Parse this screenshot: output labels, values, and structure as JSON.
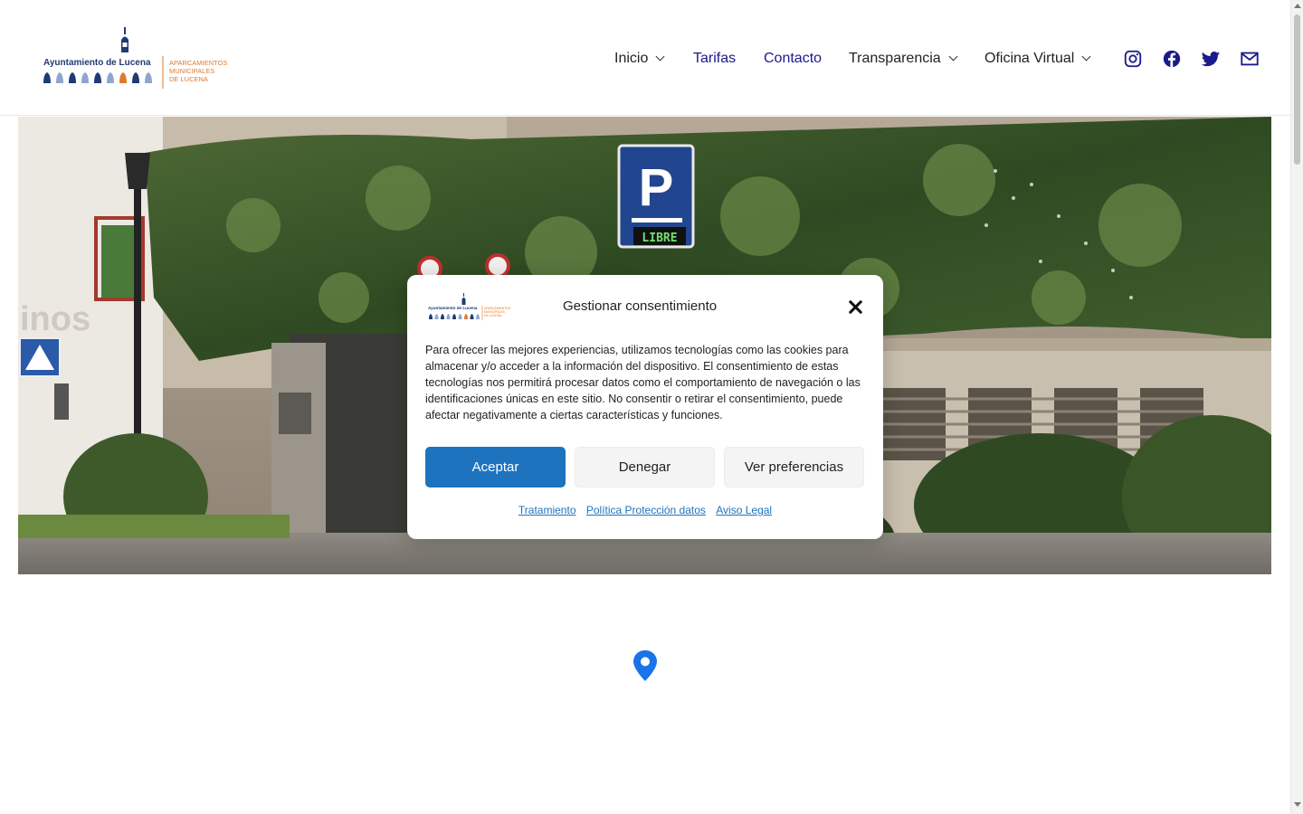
{
  "header": {
    "logo": {
      "title": "Ayuntamiento de Lucena",
      "subtitle_lines": [
        "APARCAMIENTOS",
        "MUNICIPALES",
        "DE LUCENA"
      ]
    },
    "nav": [
      {
        "label": "Inicio",
        "has_dropdown": true,
        "color": "#222222"
      },
      {
        "label": "Tarifas",
        "has_dropdown": false,
        "color": "#1a1a8c"
      },
      {
        "label": "Contacto",
        "has_dropdown": false,
        "color": "#1a1a8c"
      },
      {
        "label": "Transparencia",
        "has_dropdown": true,
        "color": "#222222"
      },
      {
        "label": "Oficina Virtual",
        "has_dropdown": true,
        "color": "#222222"
      }
    ],
    "social_icons": [
      "instagram-icon",
      "facebook-icon",
      "twitter-icon",
      "mail-icon"
    ],
    "social_color": "#1a1a8c"
  },
  "hero": {
    "sign_letter": "P",
    "sign_status": "LIBRE",
    "building_text": "inos"
  },
  "consent": {
    "title": "Gestionar consentimiento",
    "body": "Para ofrecer las mejores experiencias, utilizamos tecnologías como las cookies para almacenar y/o acceder a la información del dispositivo. El consentimiento de estas tecnologías nos permitirá procesar datos como el comportamiento de navegación o las identificaciones únicas en este sitio. No consentir o retirar el consentimiento, puede afectar negativamente a ciertas características y funciones.",
    "accept_label": "Aceptar",
    "deny_label": "Denegar",
    "prefs_label": "Ver preferencias",
    "links": [
      "Tratamiento",
      "Política Protección datos",
      "Aviso Legal"
    ],
    "accent_color": "#1e73be"
  },
  "map": {
    "marker_icon": "map-marker-icon",
    "marker_color": "#1a73e8"
  }
}
